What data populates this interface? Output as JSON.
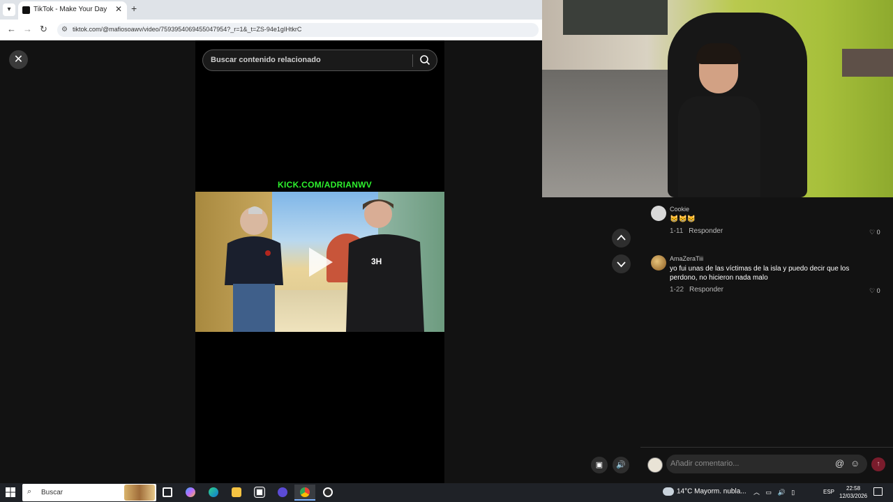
{
  "browser": {
    "tab_title": "TikTok - Make Your Day",
    "url": "tiktok.com/@mafiosoawv/video/7593954069455047954?_r=1&_t=ZS-94e1gIHtkrC"
  },
  "viewer": {
    "search_placeholder": "Buscar contenido relacionado",
    "video_overlay_text": "KICK.COM/ADRIANWV"
  },
  "comments": [
    {
      "user": "Cookie",
      "text": "😸😸😸",
      "date": "1-11",
      "reply_label": "Responder",
      "likes": "0"
    },
    {
      "user": "AmaZeraTiii",
      "text": "yo fui unas de las víctimas de la isla y puedo decir que los perdono, no hicieron nada malo",
      "date": "1-22",
      "reply_label": "Responder",
      "likes": "0"
    }
  ],
  "comment_input": {
    "placeholder": "Añadir comentario..."
  },
  "taskbar": {
    "search_label": "Buscar",
    "weather": "14°C  Mayorm. nubla...",
    "language": "ESP",
    "time": "22:58",
    "date": "12/03/2026"
  },
  "colors": {
    "accent_red": "#fe2c55",
    "kick_green": "#2ef22e"
  }
}
